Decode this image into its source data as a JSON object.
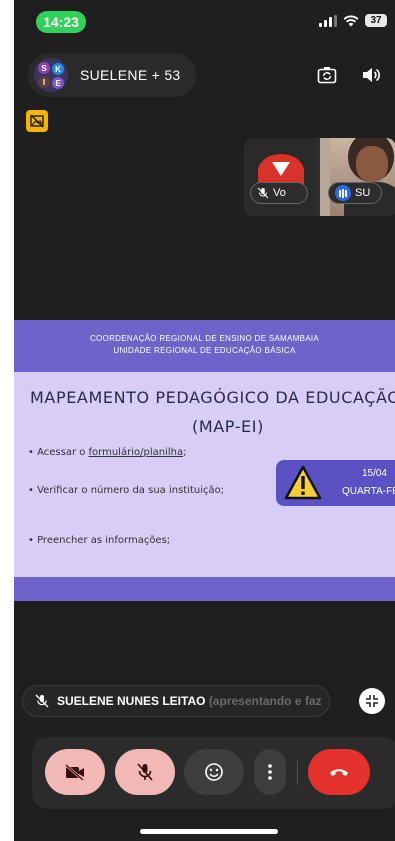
{
  "status_bar": {
    "time": "14:23",
    "battery": "37"
  },
  "header": {
    "host_label": "SUELENE + 53",
    "avatar_initials": [
      "S",
      "K",
      "I",
      "E"
    ]
  },
  "tiles": [
    {
      "label": "Vo",
      "muted": true
    },
    {
      "label": "SU",
      "speaking": true
    }
  ],
  "slide": {
    "header_line1": "COORDENAÇÃO REGIONAL DE ENSINO DE SAMAMBAIA",
    "header_line2": "UNIDADE REGIONAL DE EDUCAÇÃO BÁSICA",
    "title_line1": "MAPEAMENTO PEDAGÓGICO DA EDUCAÇÃO INFAN",
    "title_line2": "(MAP-EI)",
    "bullet1_prefix": "• Acessar o ",
    "bullet1_link": "formulário/planilha",
    "bullet1_suffix": ";",
    "bullet2": "• Verificar o número da sua instituição;",
    "bullet3": "• Preencher as informações;",
    "warning_date": "15/04",
    "warning_day": "QUARTA-FE"
  },
  "presenter": {
    "name": "SUELENE NUNES LEITAO",
    "status": "(apresentando e faz"
  },
  "controls": [
    {
      "name": "camera-off-button",
      "icon": "camera-off-icon"
    },
    {
      "name": "mic-off-button",
      "icon": "mic-off-icon"
    },
    {
      "name": "reactions-button",
      "icon": "smiley-icon"
    },
    {
      "name": "more-options-button",
      "icon": "more-vertical-icon"
    },
    {
      "name": "end-call-button",
      "icon": "end-call-icon"
    }
  ],
  "colors": {
    "time_pill": "#2fd35a",
    "slide_header": "#6d63c9",
    "slide_body": "#d7cdf7",
    "control_pink": "#f2b8b5",
    "end_call": "#e5312b",
    "warning_yellow": "#f4d130"
  }
}
